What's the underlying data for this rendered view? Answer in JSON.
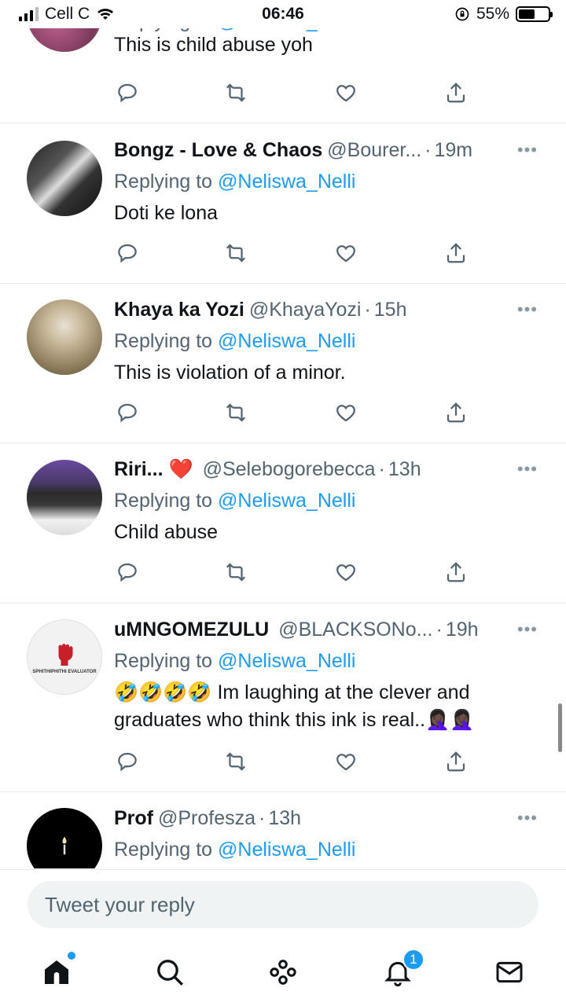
{
  "status_bar": {
    "carrier": "Cell C",
    "time": "06:46",
    "battery_text": "55%",
    "battery_level": 0.55
  },
  "partial_tweet": {
    "reply_to_label": "Replying to",
    "mention": "@Neliswa_Nelli",
    "text": "This is child abuse yoh"
  },
  "tweets": [
    {
      "name": "Bongz - Love & Chaos",
      "handle": "@Bourer...",
      "time": "19m",
      "reply_to_label": "Replying to",
      "mention": "@Neliswa_Nelli",
      "text": "Doti ke lona"
    },
    {
      "name": "Khaya ka Yozi",
      "handle": "@KhayaYozi",
      "time": "15h",
      "reply_to_label": "Replying to",
      "mention": "@Neliswa_Nelli",
      "text": "This is violation of a minor."
    },
    {
      "name": "Riri... ❤️",
      "handle": "@Selebogorebecca",
      "time": "13h",
      "reply_to_label": "Replying to",
      "mention": "@Neliswa_Nelli",
      "text": "Child abuse"
    },
    {
      "name": "uMNGOMEZULU",
      "handle": "@BLACKSONo...",
      "time": "19h",
      "reply_to_label": "Replying to",
      "mention": "@Neliswa_Nelli",
      "text": "🤣🤣🤣🤣 Im laughing at the clever and graduates who think this ink is real..🤦🏿‍♀️🤦🏿‍♀️",
      "avatar_text": "SPHITHIPHITHI EVALUATOR"
    },
    {
      "name": "Prof",
      "handle": "@Profesza",
      "time": "13h",
      "reply_to_label": "Replying to",
      "mention": "@Neliswa_Nelli",
      "text": ""
    }
  ],
  "reply_bar": {
    "placeholder": "Tweet your reply"
  },
  "tab_bar": {
    "notification_count": "1"
  },
  "colors": {
    "accent": "#1d9bf0",
    "text": "#0f1419",
    "muted": "#536471"
  }
}
